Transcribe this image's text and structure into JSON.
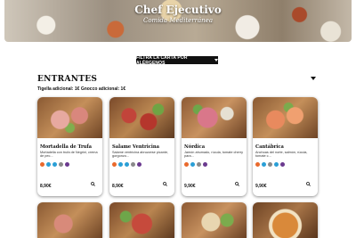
{
  "hero": {
    "title": "Chef Ejecutivo",
    "subtitle": "Comida Mediterránea"
  },
  "allergen_filter": {
    "label": "FILTRA LA CARTA POR ALÉRGENOS"
  },
  "section": {
    "title": "ENTRANTES",
    "subtitle": "Tigella adicional: 1€ Gnocco adicional: 1€"
  },
  "cards": [
    {
      "name": "Mortadella de Trufa",
      "desc": "Mortadella con trufa de Negrini, crema de pec...",
      "price": "8,90€",
      "allergens": [
        "#e9692c",
        "#2a9fd6",
        "#2a9fd6",
        "#8a8a8a",
        "#6b3a8f"
      ]
    },
    {
      "name": "Salame Ventricina",
      "desc": "Salame ventricina abruzzese picante, gorgonzo...",
      "price": "8,90€",
      "allergens": [
        "#e9692c",
        "#2a9fd6",
        "#2a9fd6",
        "#8a8a8a",
        "#6b3a8f"
      ]
    },
    {
      "name": "Nórdica",
      "desc": "Jamón ahumado, rúcula, tomate cherry para...",
      "price": "9,90€",
      "allergens": [
        "#e9692c",
        "#2a9fd6",
        "#8a8a8a",
        "#6b3a8f"
      ]
    },
    {
      "name": "Cantábrica",
      "desc": "Anchoas del norte, salmón, rúcula, tomate c...",
      "price": "9,90€",
      "allergens": [
        "#e9692c",
        "#2a9fd6",
        "#8a8a8a",
        "#2a9fd6",
        "#6b3a8f"
      ]
    }
  ]
}
